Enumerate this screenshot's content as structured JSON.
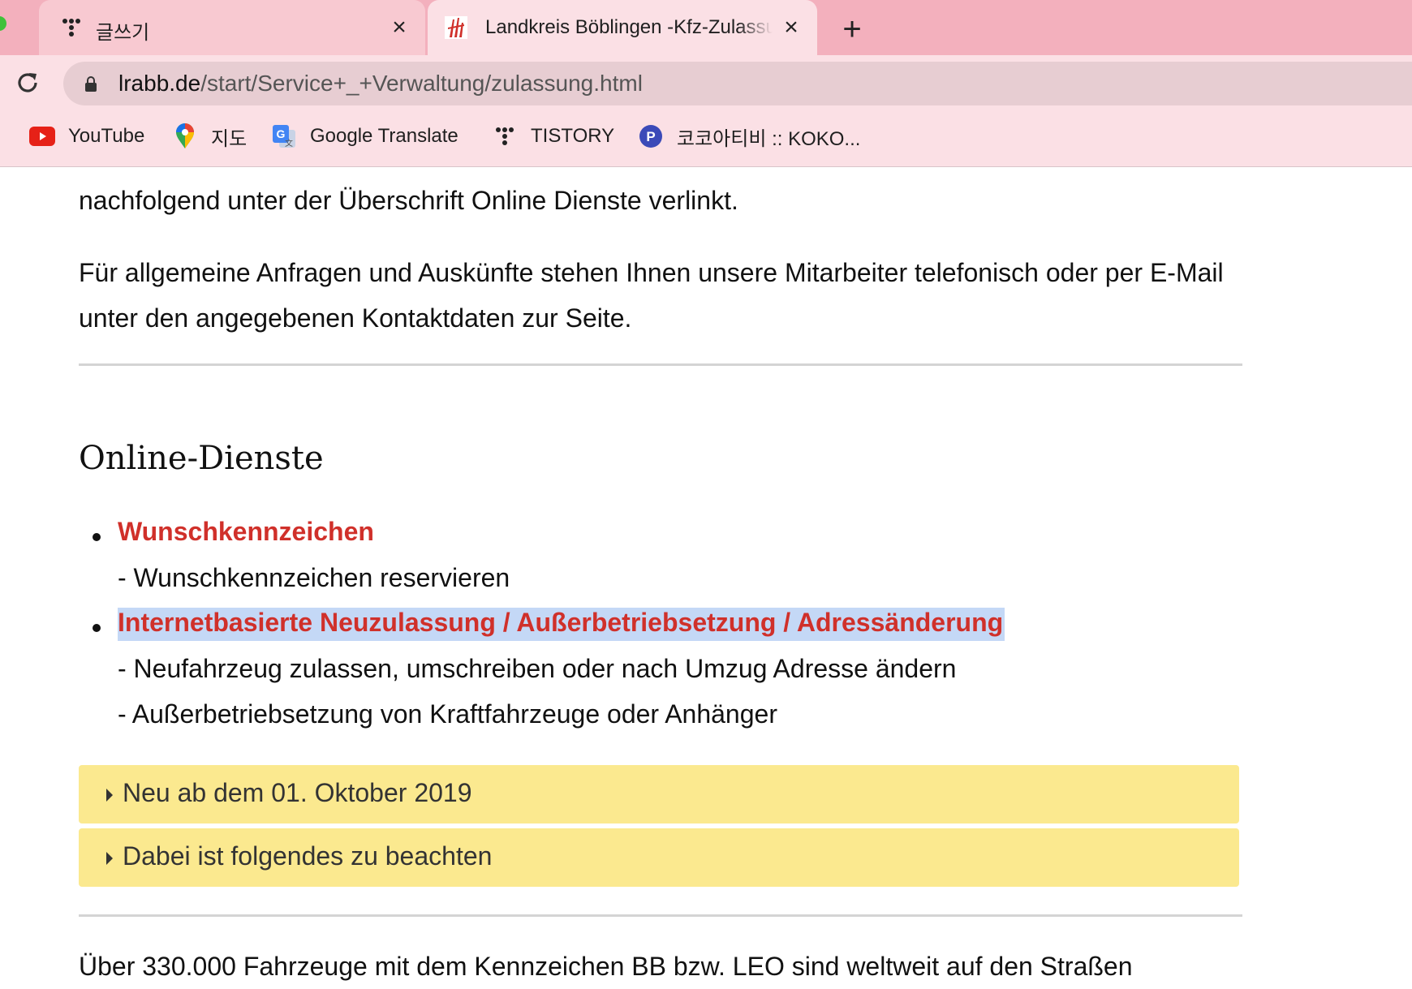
{
  "browser": {
    "tabs": [
      {
        "title": "글쓰기",
        "icon": "tistory-icon",
        "active": false
      },
      {
        "title": "Landkreis Böblingen -Kfz-Zulassung",
        "icon": "landkreis-logo-icon",
        "active": true
      }
    ],
    "new_tab_label": "+",
    "url_host": "lrabb.de",
    "url_path": "/start/Service+_+Verwaltung/zulassung.html",
    "bookmarks": [
      {
        "label": "YouTube",
        "icon": "youtube-icon"
      },
      {
        "label": "지도",
        "icon": "maps-pin-icon"
      },
      {
        "label": "Google Translate",
        "icon": "google-translate-icon"
      },
      {
        "label": "TISTORY",
        "icon": "tistory-icon"
      },
      {
        "label": "코코아티비 :: KOKO...",
        "icon": "p-badge-icon"
      }
    ]
  },
  "page": {
    "intro_line": "nachfolgend unter der Überschrift Online Dienste verlinkt.",
    "contact_paragraph": "Für allgemeine Anfragen und Auskünfte stehen Ihnen unsere Mitarbeiter telefonisch oder per E-Mail unter den angegebenen Kontaktdaten zur Seite.",
    "section_heading": "Online-Dienste",
    "services": [
      {
        "link": "Wunschkennzeichen",
        "descriptions": [
          "- Wunschkennzeichen reservieren"
        ]
      },
      {
        "link": "Internetbasierte Neuzulassung / Außerbetriebsetzung / Adressänderung",
        "descriptions": [
          "- Neufahrzeug zulassen, umschreiben oder nach Umzug Adresse ändern",
          "- Außerbetriebsetzung von Kraftfahrzeuge oder Anhänger"
        ]
      }
    ],
    "accordions": [
      {
        "label": "Neu ab dem 01. Oktober 2019"
      },
      {
        "label": "Dabei ist folgendes zu beachten"
      }
    ],
    "footer_line": "Über 330.000 Fahrzeuge mit dem Kennzeichen BB bzw. LEO sind weltweit auf den Straßen"
  },
  "colors": {
    "link": "#d0302a",
    "accordion_bg": "#fbe98f",
    "selection": "#c4d8f6",
    "tabstrip": "#f3b0bd"
  }
}
